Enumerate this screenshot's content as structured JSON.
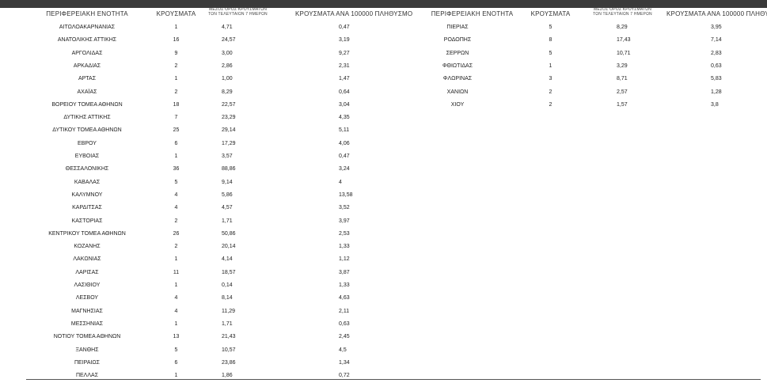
{
  "headers": {
    "region": "ΠΕΡΙΦΕΡΕΙΑΚΗ ΕΝΟΤΗΤΑ",
    "cases": "ΚΡΟΥΣΜΑΤΑ",
    "avg7": "ΜΕΣΟΣ ΟΡΟΣ ΚΡΟΥΣΜΑΤΩΝ ΤΩΝ ΤΕΛΕΥΤΑΙΩΝ 7 ΗΜΕΡΩΝ",
    "per100k": "ΚΡΟΥΣΜΑΤΑ ΑΝΑ 100000 ΠΛΗΘΥΣΜΟ"
  },
  "left_rows": [
    {
      "name": "ΑΙΤΩΛΟΑΚΑΡΝΑΝΙΑΣ",
      "cases": "1",
      "avg": "4,71",
      "per": "0,47"
    },
    {
      "name": "ΑΝΑΤΟΛΙΚΗΣ ΑΤΤΙΚΗΣ",
      "cases": "16",
      "avg": "24,57",
      "per": "3,19"
    },
    {
      "name": "ΑΡΓΟΛΙΔΑΣ",
      "cases": "9",
      "avg": "3,00",
      "per": "9,27"
    },
    {
      "name": "ΑΡΚΑΔΙΑΣ",
      "cases": "2",
      "avg": "2,86",
      "per": "2,31"
    },
    {
      "name": "ΑΡΤΑΣ",
      "cases": "1",
      "avg": "1,00",
      "per": "1,47"
    },
    {
      "name": "ΑΧΑΪΑΣ",
      "cases": "2",
      "avg": "8,29",
      "per": "0,64"
    },
    {
      "name": "ΒΟΡΕΙΟΥ ΤΟΜΕΑ ΑΘΗΝΩΝ",
      "cases": "18",
      "avg": "22,57",
      "per": "3,04"
    },
    {
      "name": "ΔΥΤΙΚΗΣ ΑΤΤΙΚΗΣ",
      "cases": "7",
      "avg": "23,29",
      "per": "4,35"
    },
    {
      "name": "ΔΥΤΙΚΟΥ ΤΟΜΕΑ ΑΘΗΝΩΝ",
      "cases": "25",
      "avg": "29,14",
      "per": "5,11"
    },
    {
      "name": "ΕΒΡΟΥ",
      "cases": "6",
      "avg": "17,29",
      "per": "4,06"
    },
    {
      "name": "ΕΥΒΟΙΑΣ",
      "cases": "1",
      "avg": "3,57",
      "per": "0,47"
    },
    {
      "name": "ΘΕΣΣΑΛΟΝΙΚΗΣ",
      "cases": "36",
      "avg": "88,86",
      "per": "3,24"
    },
    {
      "name": "ΚΑΒΑΛΑΣ",
      "cases": "5",
      "avg": "9,14",
      "per": "4"
    },
    {
      "name": "ΚΑΛΥΜΝΟΥ",
      "cases": "4",
      "avg": "5,86",
      "per": "13,58"
    },
    {
      "name": "ΚΑΡΔΙΤΣΑΣ",
      "cases": "4",
      "avg": "4,57",
      "per": "3,52"
    },
    {
      "name": "ΚΑΣΤΟΡΙΑΣ",
      "cases": "2",
      "avg": "1,71",
      "per": "3,97"
    },
    {
      "name": "ΚΕΝΤΡΙΚΟΥ ΤΟΜΕΑ ΑΘΗΝΩΝ",
      "cases": "26",
      "avg": "50,86",
      "per": "2,53"
    },
    {
      "name": "ΚΟΖΑΝΗΣ",
      "cases": "2",
      "avg": "20,14",
      "per": "1,33"
    },
    {
      "name": "ΛΑΚΩΝΙΑΣ",
      "cases": "1",
      "avg": "4,14",
      "per": "1,12"
    },
    {
      "name": "ΛΑΡΙΣΑΣ",
      "cases": "11",
      "avg": "18,57",
      "per": "3,87"
    },
    {
      "name": "ΛΑΣΙΘΙΟΥ",
      "cases": "1",
      "avg": "0,14",
      "per": "1,33"
    },
    {
      "name": "ΛΕΣΒΟΥ",
      "cases": "4",
      "avg": "8,14",
      "per": "4,63"
    },
    {
      "name": "ΜΑΓΝΗΣΙΑΣ",
      "cases": "4",
      "avg": "11,29",
      "per": "2,11"
    },
    {
      "name": "ΜΕΣΣΗΝΙΑΣ",
      "cases": "1",
      "avg": "1,71",
      "per": "0,63"
    },
    {
      "name": "ΝΟΤΙΟΥ ΤΟΜΕΑ ΑΘΗΝΩΝ",
      "cases": "13",
      "avg": "21,43",
      "per": "2,45"
    },
    {
      "name": "ΞΑΝΘΗΣ",
      "cases": "5",
      "avg": "10,57",
      "per": "4,5"
    },
    {
      "name": "ΠΕΙΡΑΙΩΣ",
      "cases": "6",
      "avg": "23,86",
      "per": "1,34"
    },
    {
      "name": "ΠΕΛΛΑΣ",
      "cases": "1",
      "avg": "1,86",
      "per": "0,72"
    }
  ],
  "right_rows": [
    {
      "name": "ΠΙΕΡΙΑΣ",
      "cases": "5",
      "avg": "8,29",
      "per": "3,95"
    },
    {
      "name": "ΡΟΔΟΠΗΣ",
      "cases": "8",
      "avg": "17,43",
      "per": "7,14"
    },
    {
      "name": "ΣΕΡΡΩΝ",
      "cases": "5",
      "avg": "10,71",
      "per": "2,83"
    },
    {
      "name": "ΦΘΙΩΤΙΔΑΣ",
      "cases": "1",
      "avg": "3,29",
      "per": "0,63"
    },
    {
      "name": "ΦΛΩΡΙΝΑΣ",
      "cases": "3",
      "avg": "8,71",
      "per": "5,83"
    },
    {
      "name": "ΧΑΝΙΩΝ",
      "cases": "2",
      "avg": "2,57",
      "per": "1,28"
    },
    {
      "name": "ΧΙΟΥ",
      "cases": "2",
      "avg": "1,57",
      "per": "3,8"
    }
  ]
}
